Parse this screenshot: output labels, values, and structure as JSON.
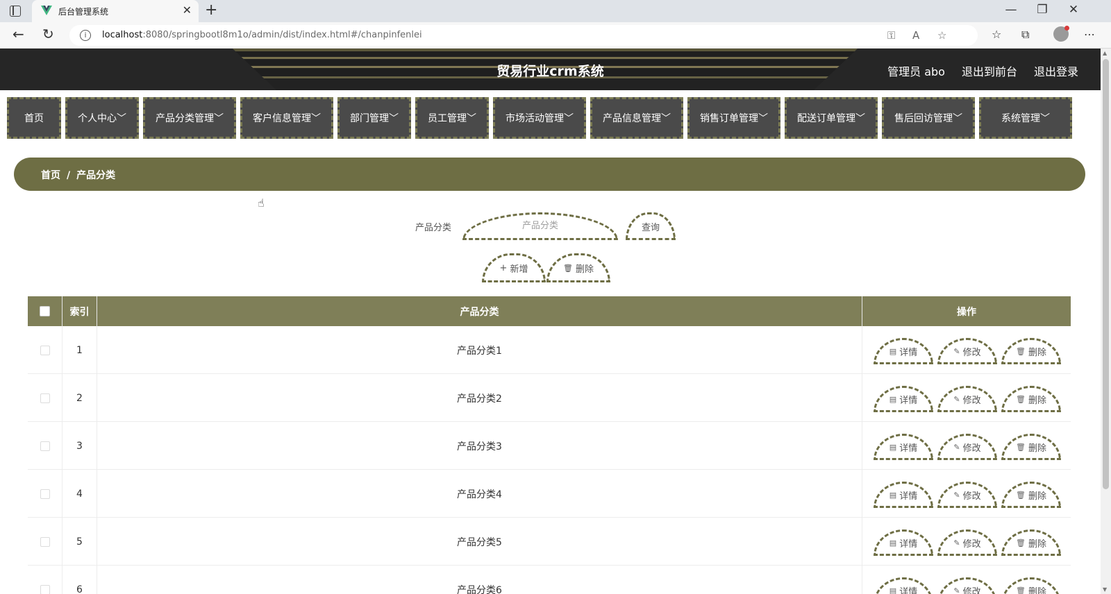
{
  "browser": {
    "tab_title": "后台管理系统",
    "url_host": "localhost",
    "url_rest": ":8080/springbootl8m1o/admin/dist/index.html#/chanpinfenlei"
  },
  "header": {
    "title": "贸易行业crm系统",
    "user_label": "管理员 abo",
    "to_front_label": "退出到前台",
    "logout_label": "退出登录"
  },
  "menu": [
    {
      "label": "首页"
    },
    {
      "label": "个人中心"
    },
    {
      "label": "产品分类管理"
    },
    {
      "label": "客户信息管理"
    },
    {
      "label": "部门管理"
    },
    {
      "label": "员工管理"
    },
    {
      "label": "市场活动管理"
    },
    {
      "label": "产品信息管理"
    },
    {
      "label": "销售订单管理"
    },
    {
      "label": "配送订单管理"
    },
    {
      "label": "售后回访管理"
    },
    {
      "label": "系统管理"
    }
  ],
  "breadcrumb": {
    "home": "首页",
    "sep": "/",
    "current": "产品分类"
  },
  "search": {
    "label": "产品分类",
    "placeholder": "产品分类",
    "query_label": "查询",
    "add_label": "新增",
    "delete_label": "删除"
  },
  "table": {
    "headers": {
      "index": "索引",
      "category": "产品分类",
      "actions": "操作"
    },
    "action_labels": {
      "detail": "详情",
      "edit": "修改",
      "delete": "删除"
    },
    "rows": [
      {
        "index": "1",
        "category": "产品分类1"
      },
      {
        "index": "2",
        "category": "产品分类2"
      },
      {
        "index": "3",
        "category": "产品分类3"
      },
      {
        "index": "4",
        "category": "产品分类4"
      },
      {
        "index": "5",
        "category": "产品分类5"
      },
      {
        "index": "6",
        "category": "产品分类6"
      }
    ]
  },
  "colors": {
    "accent": "#6e6e44",
    "table_header": "#7f7f58",
    "menu_bg": "#4a4a4a",
    "header_bg": "#262626"
  }
}
